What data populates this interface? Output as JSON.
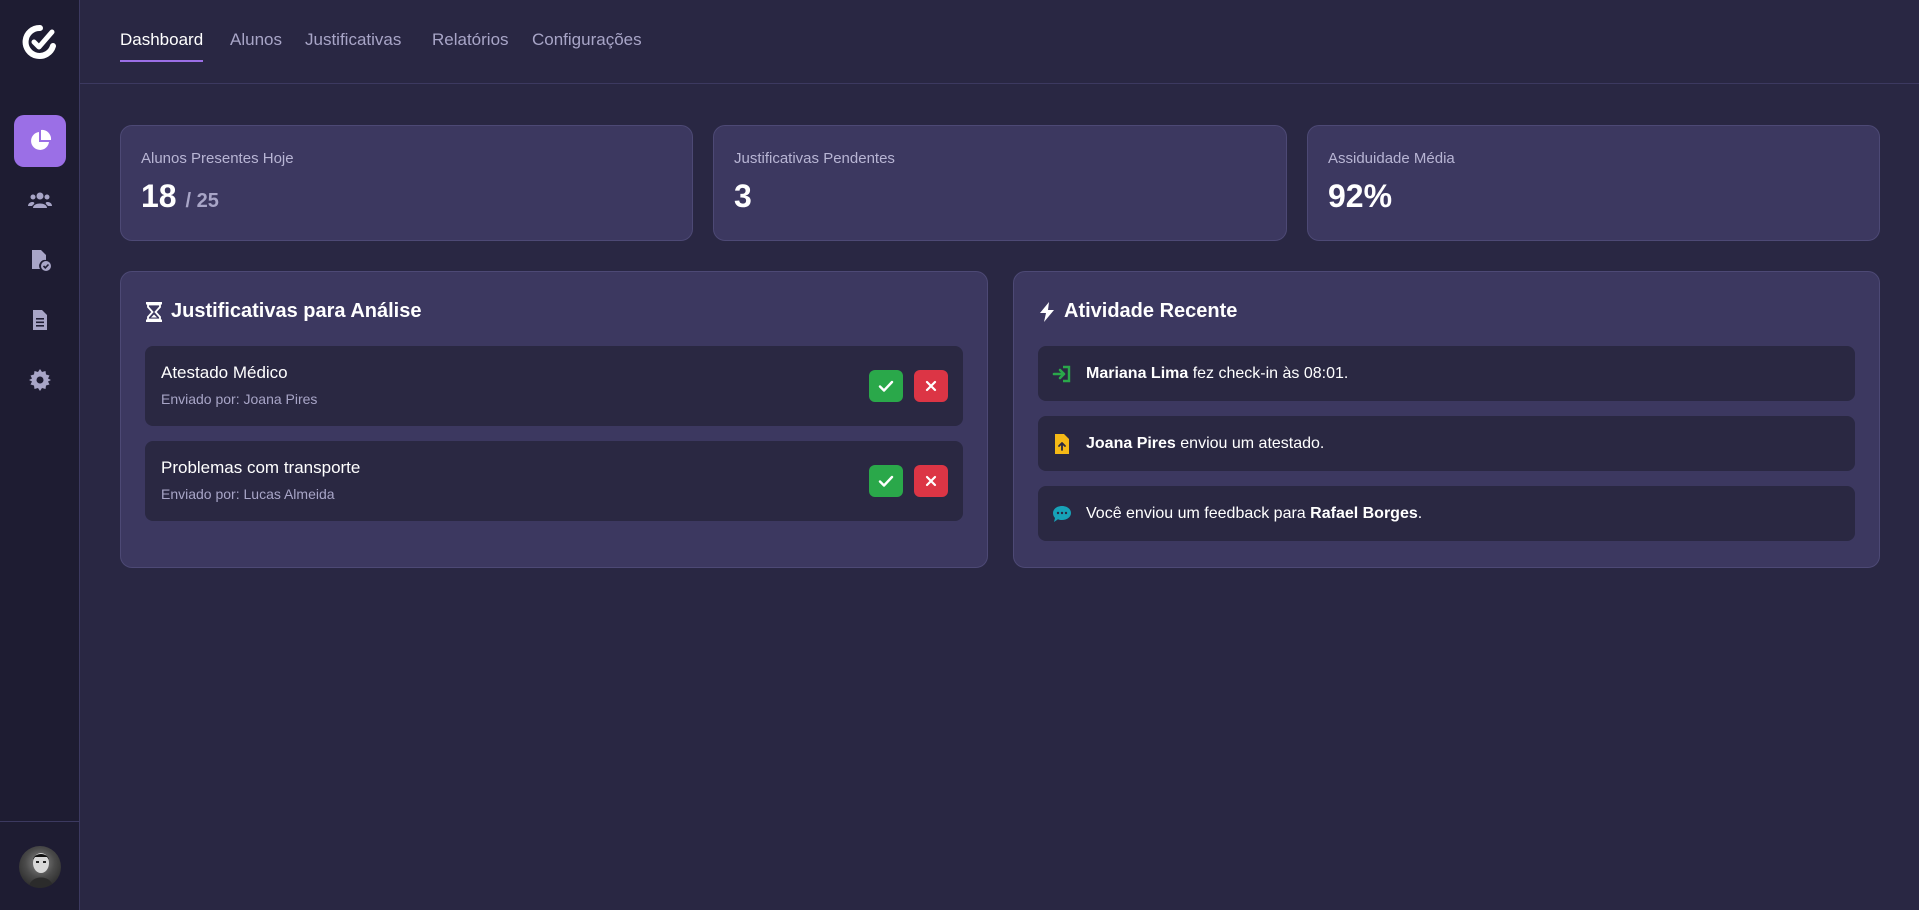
{
  "app": {
    "logo_icon": "logo-c-check-icon"
  },
  "sidebar": {
    "items": [
      {
        "name": "dashboard",
        "icon": "pie-chart-icon",
        "active": true
      },
      {
        "name": "students",
        "icon": "users-icon",
        "active": false
      },
      {
        "name": "justifications",
        "icon": "file-check-icon",
        "active": false
      },
      {
        "name": "reports",
        "icon": "document-icon",
        "active": false
      },
      {
        "name": "settings",
        "icon": "gear-icon",
        "active": false
      }
    ],
    "avatar_icon": "user-avatar"
  },
  "tabs": [
    {
      "label": "Dashboard",
      "active": true
    },
    {
      "label": "Alunos",
      "active": false
    },
    {
      "label": "Justificativas",
      "active": false
    },
    {
      "label": "Relatórios",
      "active": false
    },
    {
      "label": "Configurações",
      "active": false
    }
  ],
  "stats": [
    {
      "label": "Alunos Presentes Hoje",
      "value": "18",
      "sub": "/ 25"
    },
    {
      "label": "Justificativas Pendentes",
      "value": "3",
      "sub": ""
    },
    {
      "label": "Assiduidade Média",
      "value": "92%",
      "sub": ""
    }
  ],
  "justifications_panel": {
    "title": "Justificativas para Análise",
    "icon": "hourglass-icon",
    "items": [
      {
        "title": "Atestado Médico",
        "sender": "Enviado por: Joana Pires"
      },
      {
        "title": "Problemas com transporte",
        "sender": "Enviado por: Lucas Almeida"
      }
    ]
  },
  "activity_panel": {
    "title": "Atividade Recente",
    "icon": "bolt-icon",
    "items": [
      {
        "icon": "sign-in-icon",
        "icon_color": "#2aa84a",
        "bold": "Mariana Lima",
        "text": " fez check-in às 08:01."
      },
      {
        "icon": "file-upload-icon",
        "icon_color": "#f5b916",
        "bold": "Joana Pires",
        "text": " enviou um atestado."
      },
      {
        "icon": "comment-icon",
        "icon_color": "#17a2b8",
        "pre": "Você enviou um feedback para ",
        "bold": "Rafael Borges",
        "text": "."
      }
    ]
  },
  "colors": {
    "background": "#292743",
    "sidebar": "#1e1c32",
    "card": "#3c3860",
    "accent": "#9b6fe6",
    "approve": "#2aa84a",
    "reject": "#dc3545"
  }
}
